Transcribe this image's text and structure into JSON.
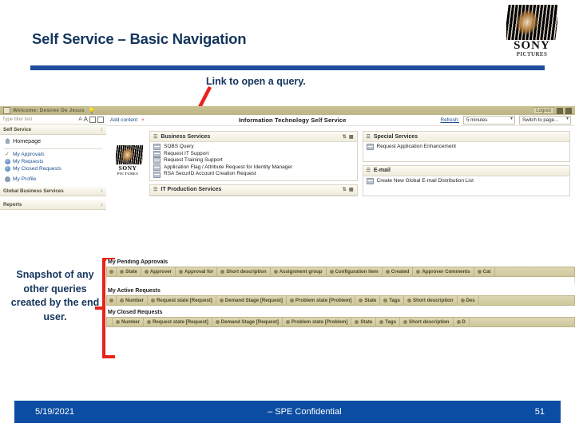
{
  "slide": {
    "title": "Self Service – Basic Navigation",
    "brand": {
      "word": "SONY",
      "sub": "PICTURES"
    },
    "callout_top": "Link to open a query.",
    "callout_left": "Snapshot of any other queries created by the end user."
  },
  "app": {
    "titlebar": {
      "welcome": "Welcome: Desiree De Jesus",
      "logout": "Logout",
      "home_icon": "home-icon",
      "print_icon": "print-icon",
      "bulb_icon": "lightbulb-icon"
    },
    "sidebar": {
      "filter_placeholder": "Type filter text",
      "font_small": "A",
      "font_large": "A",
      "refresh_icon": "refresh-icon",
      "collapse_icon": "collapse-icon",
      "sections": [
        {
          "label": "Self Service"
        },
        {
          "label": "Global Business Services"
        },
        {
          "label": "Reports"
        }
      ],
      "home_item": "Homepage",
      "items": [
        {
          "label": "My Approvals",
          "icon": "check-icon"
        },
        {
          "label": "My Requests",
          "icon": "globe-icon"
        },
        {
          "label": "My Closed Requests",
          "icon": "globe-icon"
        },
        {
          "label": "My Profile",
          "icon": "person-icon"
        }
      ]
    },
    "toolbar": {
      "add_content": "Add content",
      "close": "×",
      "app_title": "Information Technology Self Service",
      "refresh_label": "Refresh:",
      "refresh_value": "5 minutes",
      "switch_page": "Switch to page..."
    },
    "panels": [
      {
        "title": "Business Services",
        "items": [
          "SOBS Query",
          "Request IT Support",
          "Request Training Support",
          "Application Flag / Attribute Request for Identity Manager",
          "RSA SecurID Account Creation Request"
        ]
      },
      {
        "title": "IT Production Services",
        "items": []
      },
      {
        "title": "Special Services",
        "items": [
          "Request Application Enhancement"
        ]
      },
      {
        "title": "E-mail",
        "items": [
          "Create New Global E-mail Distribution List"
        ]
      }
    ]
  },
  "tables": [
    {
      "name": "My Pending Approvals",
      "columns": [
        "State",
        "Approver",
        "Approval for",
        "Short description",
        "Assignment group",
        "Configuration item",
        "Created",
        "Approver Comments",
        "Cat"
      ]
    },
    {
      "name": "My Active Requests",
      "columns": [
        "Number",
        "Request state [Request]",
        "Demand Stage [Request]",
        "Problem state [Problem]",
        "State",
        "Tags",
        "Short description",
        "Des"
      ]
    },
    {
      "name": "My Closed Requests",
      "columns": [
        "Number",
        "Request state [Request]",
        "Demand Stage [Request]",
        "Problem state [Problem]",
        "State",
        "Tags",
        "Short description",
        "D"
      ]
    }
  ],
  "footer": {
    "date": "5/19/2021",
    "confidential": "– SPE Confidential",
    "page": "51"
  },
  "colors": {
    "brand_blue": "#14355c",
    "rule_blue": "#1f4e9c",
    "footer_blue": "#0b4da2",
    "annotation_red": "#e8231a",
    "table_header": "#cfc79c",
    "titlebar": "#bdb486"
  }
}
